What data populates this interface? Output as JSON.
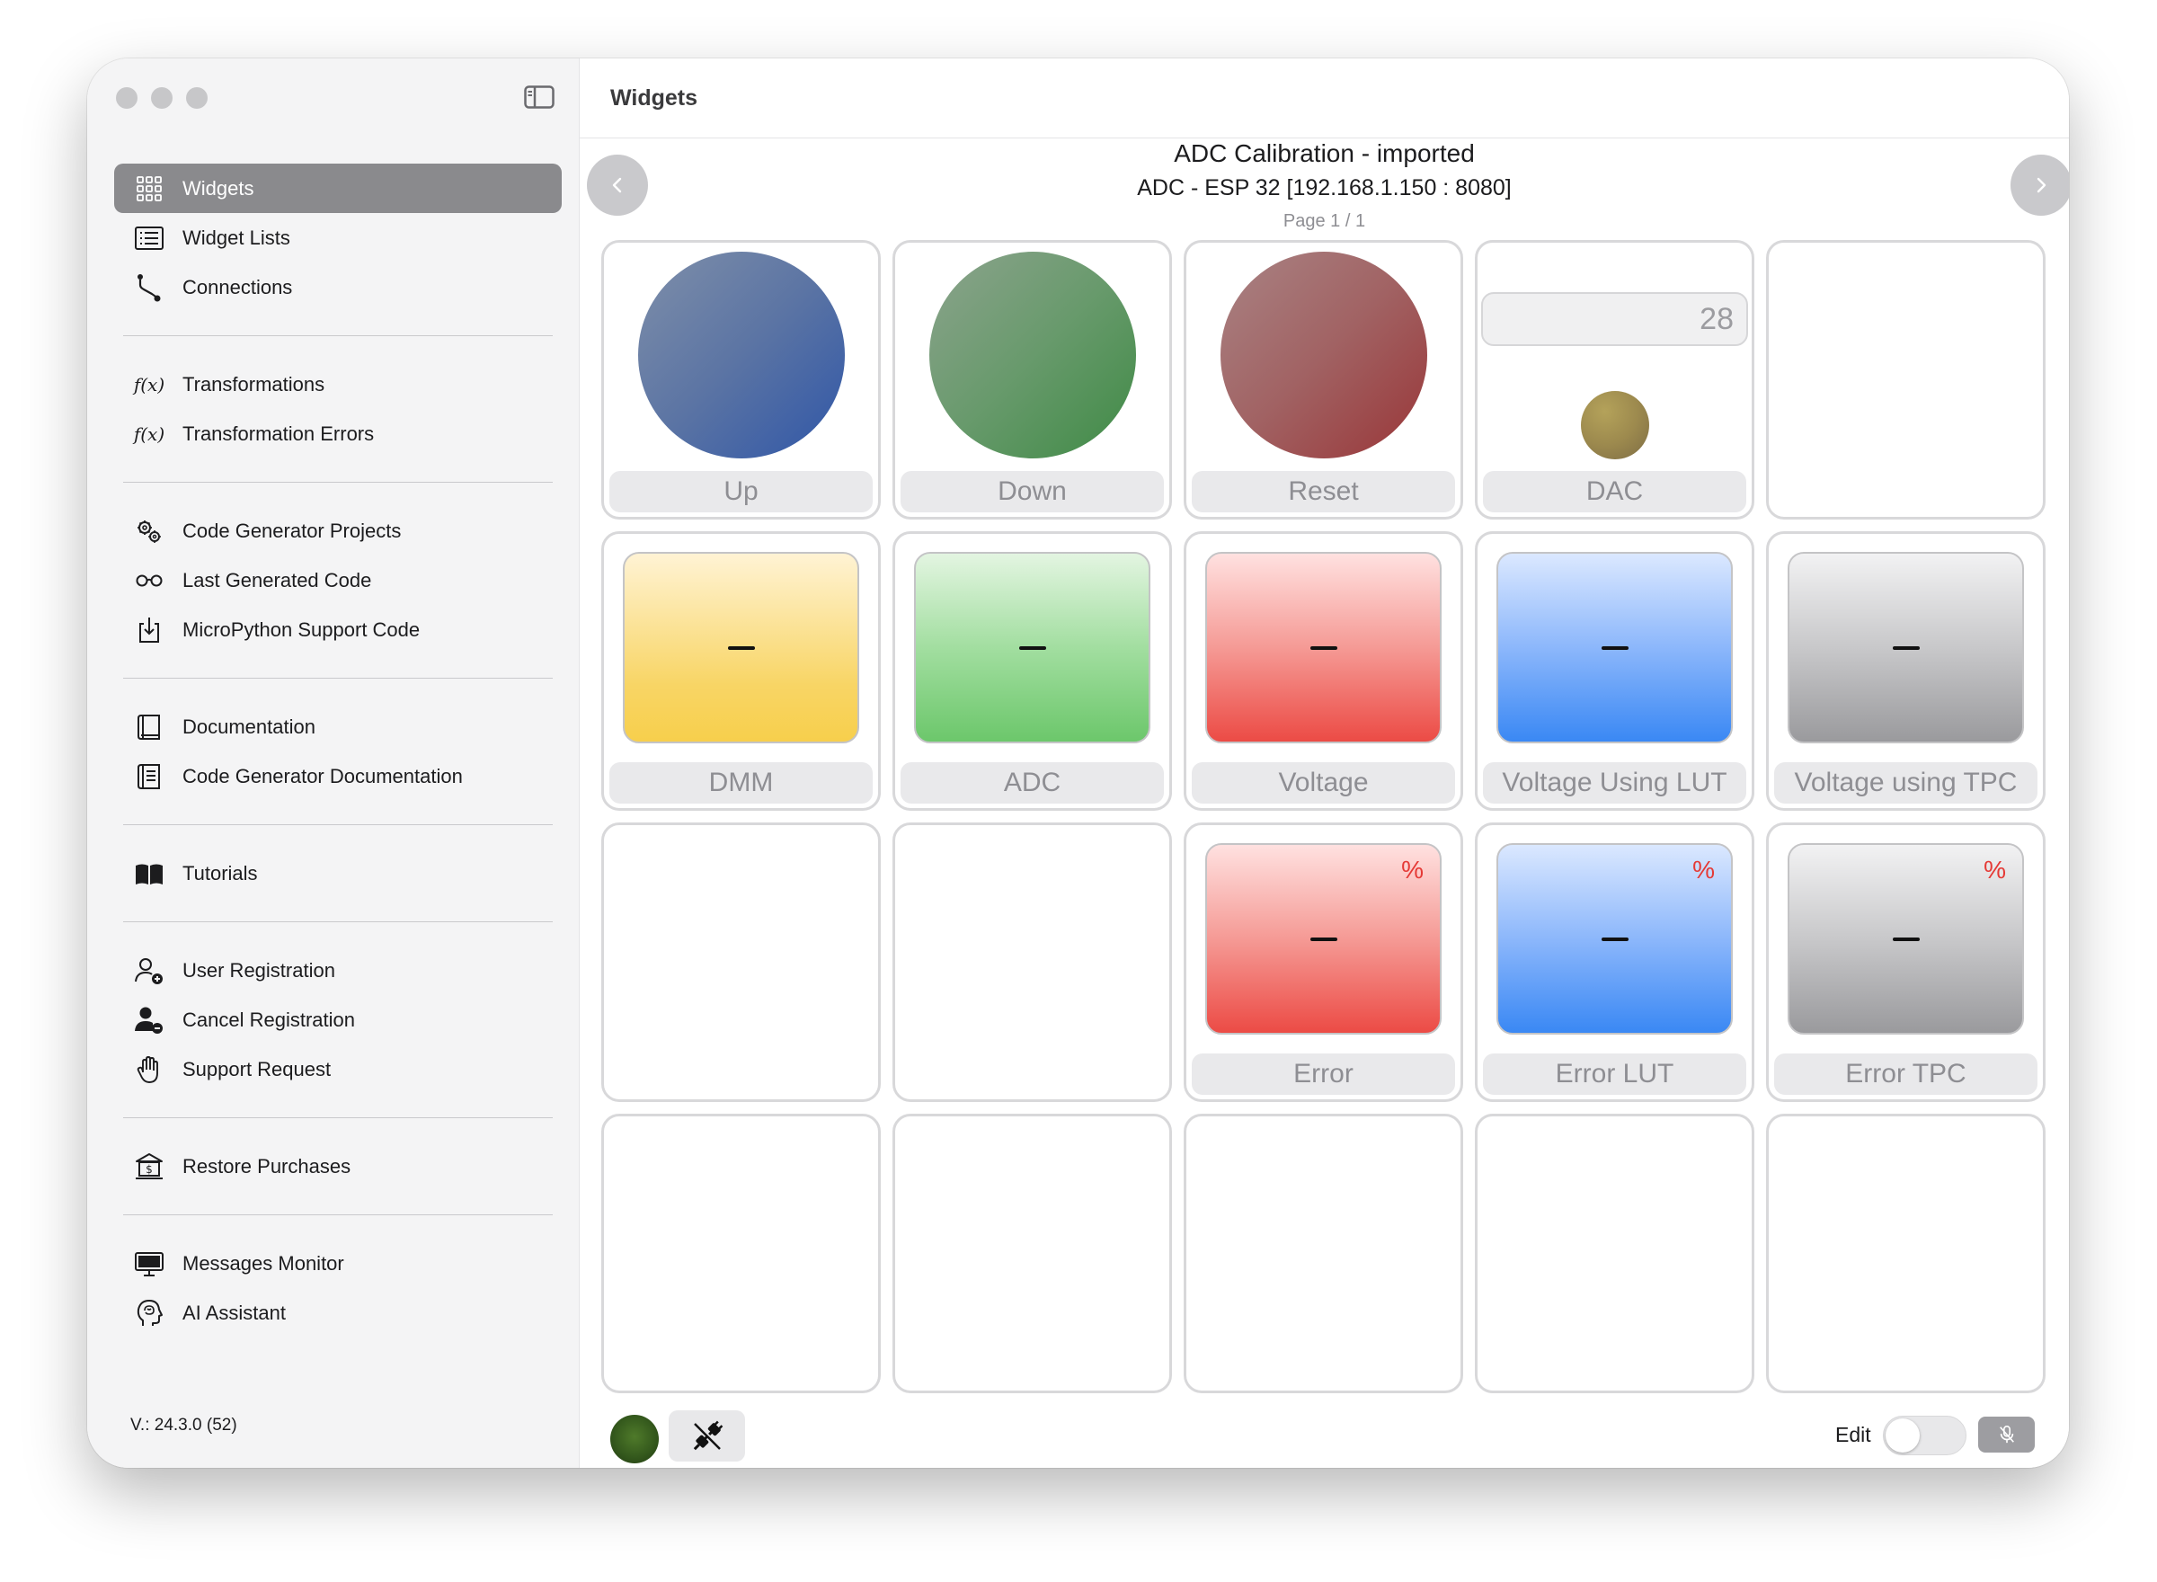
{
  "window": {
    "traffic_lights": [
      "close",
      "minimize",
      "zoom"
    ]
  },
  "sidebar": {
    "toggle_icon": "sidebar-toggle-icon",
    "sections": [
      [
        {
          "id": "widgets",
          "label": "Widgets",
          "icon": "grid-icon",
          "active": true
        },
        {
          "id": "widget-lists",
          "label": "Widget Lists",
          "icon": "list-icon"
        },
        {
          "id": "connections",
          "label": "Connections",
          "icon": "connections-icon"
        }
      ],
      [
        {
          "id": "transformations",
          "label": "Transformations",
          "icon": "function-icon",
          "glyph": "f(x)"
        },
        {
          "id": "transformation-errors",
          "label": "Transformation Errors",
          "icon": "function-icon",
          "glyph": "f(x)"
        }
      ],
      [
        {
          "id": "code-generator-projects",
          "label": "Code Generator Projects",
          "icon": "gears-icon"
        },
        {
          "id": "last-generated-code",
          "label": "Last Generated Code",
          "icon": "eyeglasses-icon"
        },
        {
          "id": "micropython-support-code",
          "label": "MicroPython Support Code",
          "icon": "download-icon"
        }
      ],
      [
        {
          "id": "documentation",
          "label": "Documentation",
          "icon": "book-icon"
        },
        {
          "id": "code-generator-documentation",
          "label": "Code Generator Documentation",
          "icon": "document-icon"
        }
      ],
      [
        {
          "id": "tutorials",
          "label": "Tutorials",
          "icon": "open-book-icon"
        }
      ],
      [
        {
          "id": "user-registration",
          "label": "User Registration",
          "icon": "person-add-icon"
        },
        {
          "id": "cancel-registration",
          "label": "Cancel Registration",
          "icon": "person-remove-icon"
        },
        {
          "id": "support-request",
          "label": "Support Request",
          "icon": "hand-icon"
        }
      ],
      [
        {
          "id": "restore-purchases",
          "label": "Restore Purchases",
          "icon": "bank-icon"
        }
      ],
      [
        {
          "id": "messages-monitor",
          "label": "Messages Monitor",
          "icon": "monitor-icon"
        },
        {
          "id": "ai-assistant",
          "label": "AI Assistant",
          "icon": "brain-head-icon"
        }
      ]
    ],
    "version": "V.: 24.3.0 (52)"
  },
  "main": {
    "title": "Widgets",
    "header": {
      "title": "ADC Calibration - imported",
      "subtitle": "ADC - ESP 32 [192.168.1.150 : 8080]",
      "page": "Page 1 / 1",
      "prev_icon": "chevron-left-icon",
      "next_icon": "chevron-right-icon"
    },
    "widgets": [
      {
        "type": "button",
        "label": "Up",
        "style": "blue"
      },
      {
        "type": "button",
        "label": "Down",
        "style": "green"
      },
      {
        "type": "button",
        "label": "Reset",
        "style": "red"
      },
      {
        "type": "slider",
        "label": "DAC",
        "value": "28"
      },
      {
        "type": "empty"
      },
      {
        "type": "display",
        "label": "DMM",
        "style": "yellow",
        "value": "–",
        "unit": ""
      },
      {
        "type": "display",
        "label": "ADC",
        "style": "green",
        "value": "–",
        "unit": ""
      },
      {
        "type": "display",
        "label": "Voltage",
        "style": "red",
        "value": "–",
        "unit": ""
      },
      {
        "type": "display",
        "label": "Voltage Using LUT",
        "style": "blue",
        "value": "–",
        "unit": ""
      },
      {
        "type": "display",
        "label": "Voltage using TPC",
        "style": "gray",
        "value": "–",
        "unit": ""
      },
      {
        "type": "empty"
      },
      {
        "type": "empty"
      },
      {
        "type": "display",
        "label": "Error",
        "style": "red",
        "value": "–",
        "unit": "%"
      },
      {
        "type": "display",
        "label": "Error LUT",
        "style": "blue",
        "value": "–",
        "unit": "%"
      },
      {
        "type": "display",
        "label": "Error TPC",
        "style": "gray",
        "value": "–",
        "unit": "%"
      },
      {
        "type": "empty"
      },
      {
        "type": "empty"
      },
      {
        "type": "empty"
      },
      {
        "type": "empty"
      },
      {
        "type": "empty"
      }
    ],
    "footer": {
      "status_icon": "connection-status-indicator",
      "plug_icon": "plug-disconnected-icon",
      "edit_label": "Edit",
      "edit_enabled": false,
      "mic_icon": "microphone-slash-icon"
    }
  }
}
